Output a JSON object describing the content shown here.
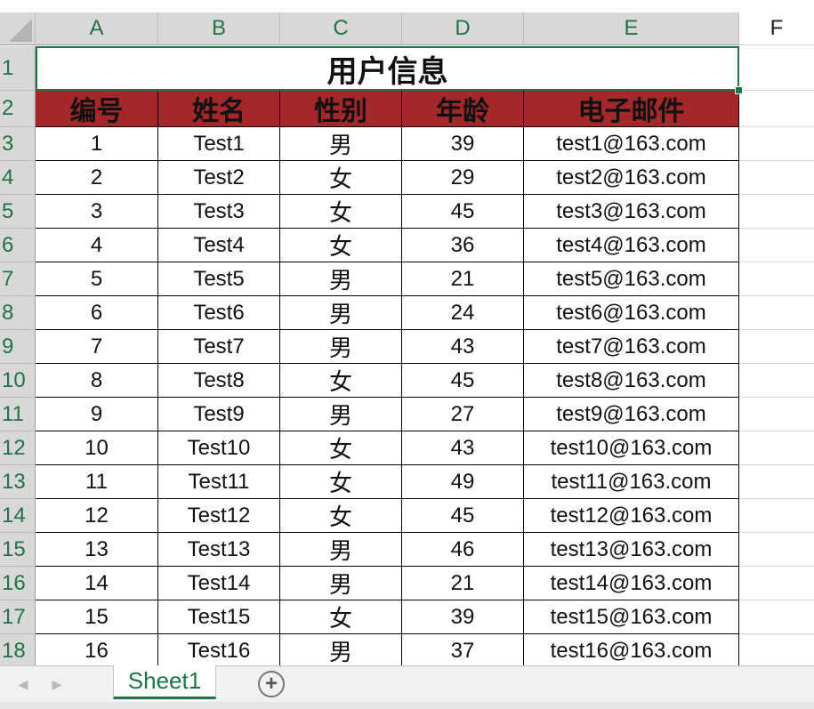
{
  "columns": [
    "A",
    "B",
    "C",
    "D",
    "E",
    "F"
  ],
  "rows": [
    "1",
    "2",
    "3",
    "4",
    "5",
    "6",
    "7",
    "8",
    "9",
    "10",
    "11",
    "12",
    "13",
    "14",
    "15",
    "16",
    "17",
    "18"
  ],
  "title": "用户信息",
  "headers": [
    "编号",
    "姓名",
    "性别",
    "年龄",
    "电子邮件"
  ],
  "records": [
    [
      "1",
      "Test1",
      "男",
      "39",
      "test1@163.com"
    ],
    [
      "2",
      "Test2",
      "女",
      "29",
      "test2@163.com"
    ],
    [
      "3",
      "Test3",
      "女",
      "45",
      "test3@163.com"
    ],
    [
      "4",
      "Test4",
      "女",
      "36",
      "test4@163.com"
    ],
    [
      "5",
      "Test5",
      "男",
      "21",
      "test5@163.com"
    ],
    [
      "6",
      "Test6",
      "男",
      "24",
      "test6@163.com"
    ],
    [
      "7",
      "Test7",
      "男",
      "43",
      "test7@163.com"
    ],
    [
      "8",
      "Test8",
      "女",
      "45",
      "test8@163.com"
    ],
    [
      "9",
      "Test9",
      "男",
      "27",
      "test9@163.com"
    ],
    [
      "10",
      "Test10",
      "女",
      "43",
      "test10@163.com"
    ],
    [
      "11",
      "Test11",
      "女",
      "49",
      "test11@163.com"
    ],
    [
      "12",
      "Test12",
      "女",
      "45",
      "test12@163.com"
    ],
    [
      "13",
      "Test13",
      "男",
      "46",
      "test13@163.com"
    ],
    [
      "14",
      "Test14",
      "男",
      "21",
      "test14@163.com"
    ],
    [
      "15",
      "Test15",
      "女",
      "39",
      "test15@163.com"
    ],
    [
      "16",
      "Test16",
      "男",
      "37",
      "test16@163.com"
    ]
  ],
  "sheet_tabs": [
    "Sheet1"
  ],
  "colors": {
    "header_fill": "#a4282a",
    "accent": "#217346"
  },
  "icons": {
    "prev": "chevron-left-icon",
    "next": "chevron-right-icon",
    "add": "plus-circle-icon"
  }
}
